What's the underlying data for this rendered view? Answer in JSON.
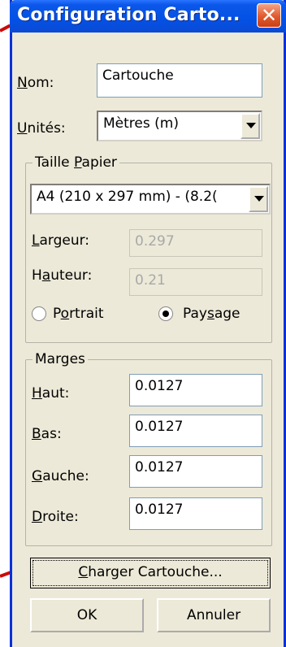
{
  "window": {
    "title": "Configuration Carto...",
    "close_label": "✕"
  },
  "form": {
    "nom_label": "Nom:",
    "nom_value": "Cartouche",
    "unites_label": "Unités:",
    "unites_value": "Mètres (m)"
  },
  "paper": {
    "group_title": "Taille Papier",
    "size_value": "A4 (210 x 297 mm) - (8.2(",
    "largeur_label": "Largeur:",
    "largeur_value": "0.297",
    "hauteur_label": "Hauteur:",
    "hauteur_value": "0.21",
    "portrait_label": "Portrait",
    "paysage_label": "Paysage",
    "orientation_selected": "Paysage"
  },
  "margins": {
    "group_title": "Marges",
    "haut_label": "Haut:",
    "haut_value": "0.0127",
    "bas_label": "Bas:",
    "bas_value": "0.0127",
    "gauche_label": "Gauche:",
    "gauche_value": "0.0127",
    "droite_label": "Droite:",
    "droite_value": "0.0127"
  },
  "buttons": {
    "load": "Charger Cartouche...",
    "ok": "OK",
    "cancel": "Annuler"
  },
  "colors": {
    "annotation_arrow": "#cc0a0a",
    "titlebar": "#0451e6"
  }
}
